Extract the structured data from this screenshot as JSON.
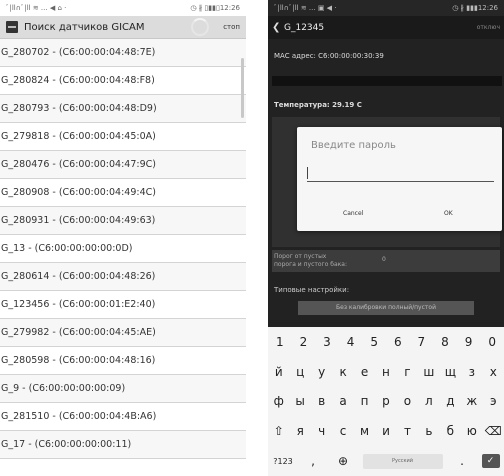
{
  "left": {
    "statusbar": {
      "left": "ﾞ|ll∩ﾞ|ll ≋ ... ◀ ⌂ ⋅",
      "right": "◷ ∦ ▯▮▮▯12:26"
    },
    "appbar": {
      "title": "Поиск датчиков GICAM",
      "stop": "стоп"
    },
    "devices": [
      "G_280702  -  (C6:00:00:04:48:7E)",
      "G_280824  -  (C6:00:00:04:48:F8)",
      "G_280793  -  (C6:00:00:04:48:D9)",
      "G_279818  -  (C6:00:00:04:45:0A)",
      "G_280476  -  (C6:00:00:04:47:9C)",
      "G_280908  -  (C6:00:00:04:49:4C)",
      "G_280931  -  (C6:00:00:04:49:63)",
      "G_13  -  (C6:00:00:00:00:0D)",
      "G_280614  -  (C6:00:00:04:48:26)",
      "G_123456  -  (C6:00:00:01:E2:40)",
      "G_279982  -  (C6:00:00:04:45:AE)",
      "G_280598  -  (C6:00:00:04:48:16)",
      "G_9  -  (C6:00:00:00:00:09)",
      "G_281510  -  (C6:00:00:04:4B:A6)",
      "G_17  -  (C6:00:00:00:00:11)"
    ]
  },
  "right": {
    "statusbar": {
      "left": "ﾞ|ll∩ﾞ|ll ≋ ... ▣ ◀ ⋅",
      "right": "◷ ∦ ▮▮▮12:26"
    },
    "appbar": {
      "title": "G_12345",
      "action": "отключ"
    },
    "mac": "MAC адрес: C6:00:00:00:30:39",
    "temperature": "Температура: 29.19 C",
    "bg_text": "Порог от пустых\nпорога и пустого бака:",
    "bg_value": "0",
    "settings_label": "Типовые настройки:",
    "calibrate_button": "Без калибровки полный/пустой",
    "dialog": {
      "title": "Введите пароль",
      "password_value": "",
      "cancel": "Cancel",
      "ok": "OK"
    },
    "keyboard": {
      "row1": [
        "1",
        "2",
        "3",
        "4",
        "5",
        "6",
        "7",
        "8",
        "9",
        "0"
      ],
      "row2": [
        "й",
        "ц",
        "у",
        "к",
        "е",
        "н",
        "г",
        "ш",
        "щ",
        "з",
        "х"
      ],
      "row3": [
        "ф",
        "ы",
        "в",
        "а",
        "п",
        "р",
        "о",
        "л",
        "д",
        "ж",
        "э"
      ],
      "row4": [
        "⇧",
        "я",
        "ч",
        "с",
        "м",
        "и",
        "т",
        "ь",
        "б",
        "ю",
        "⌫"
      ],
      "symbols": "?123",
      "comma": ",",
      "globe": "⊕",
      "space": "Русский",
      "period": ".",
      "enter": "✓"
    }
  }
}
